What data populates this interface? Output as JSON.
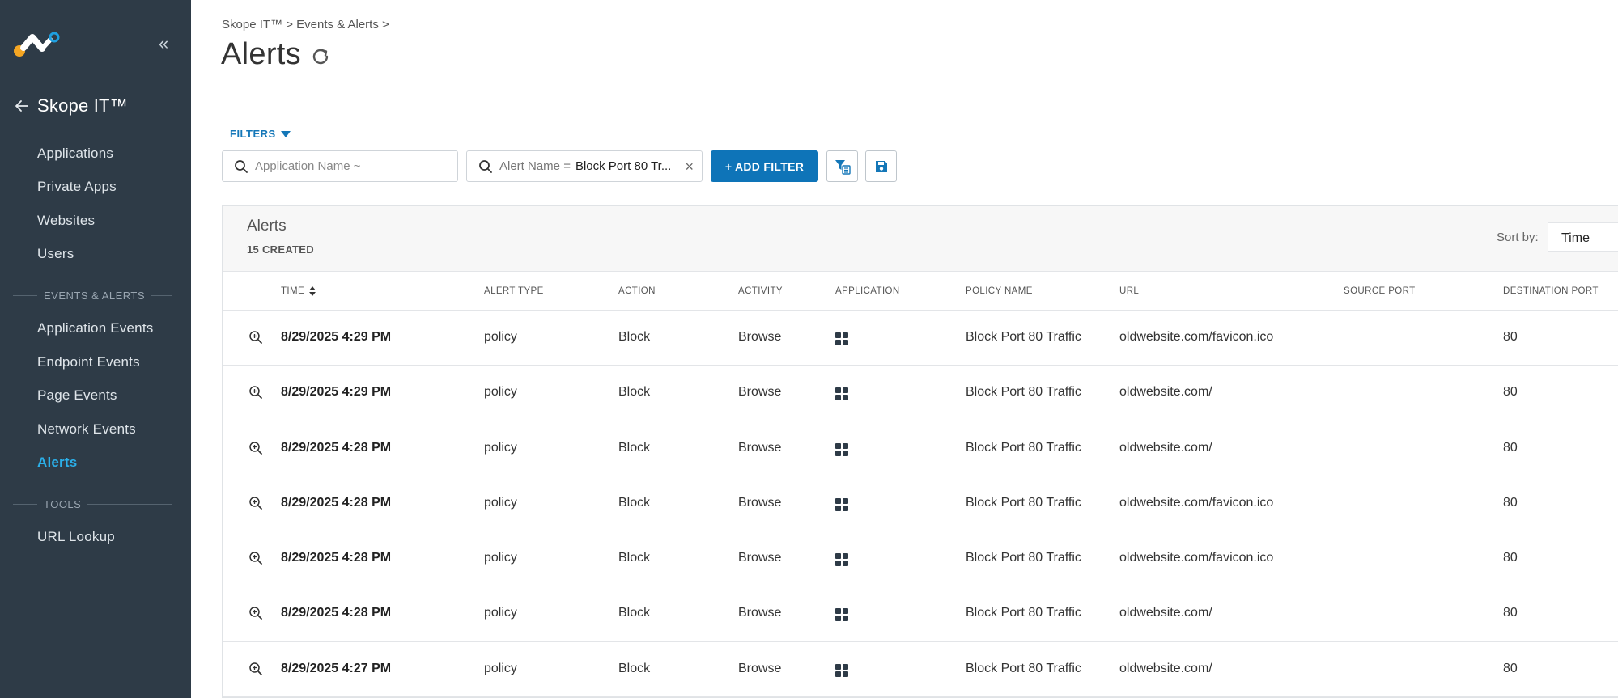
{
  "sidebar": {
    "back_label": "Skope IT™",
    "items": [
      {
        "label": "Applications",
        "active": false
      },
      {
        "label": "Private Apps",
        "active": false
      },
      {
        "label": "Websites",
        "active": false
      },
      {
        "label": "Users",
        "active": false
      }
    ],
    "section_events": "EVENTS & ALERTS",
    "event_items": [
      {
        "label": "Application Events",
        "active": false
      },
      {
        "label": "Endpoint Events",
        "active": false
      },
      {
        "label": "Page Events",
        "active": false
      },
      {
        "label": "Network Events",
        "active": false
      },
      {
        "label": "Alerts",
        "active": true
      }
    ],
    "section_tools": "TOOLS",
    "tool_items": [
      {
        "label": "URL Lookup",
        "active": false
      }
    ],
    "colors": {
      "background": "#2e3b47",
      "active": "#2bb0ea",
      "logo_orange": "#f5a623",
      "logo_blue": "#1e9fe0"
    }
  },
  "header": {
    "breadcrumb": "Skope IT™ > Events & Alerts >",
    "title": "Alerts",
    "refresh_icon": "refresh-icon"
  },
  "filters": {
    "toggle_label": "FILTERS",
    "app_name_placeholder": "Application Name ~",
    "alert_chip_key": "Alert Name =",
    "alert_chip_value": "Block Port 80 Tr...",
    "add_filter_label": "+ ADD FILTER",
    "accent": "#0e74b8"
  },
  "panel": {
    "title": "Alerts",
    "count": "15 CREATED",
    "sort_label": "Sort by:",
    "sort_value": "Time"
  },
  "table": {
    "columns": {
      "time": "TIME",
      "alert_type": "ALERT TYPE",
      "action": "ACTION",
      "activity": "ACTIVITY",
      "application": "APPLICATION",
      "policy_name": "POLICY NAME",
      "url": "URL",
      "source_port": "SOURCE PORT",
      "destination_port": "DESTINATION PORT"
    },
    "rows": [
      {
        "time": "8/29/2025 4:29 PM",
        "alert_type": "policy",
        "action": "Block",
        "activity": "Browse",
        "policy_name": "Block Port 80 Traffic",
        "url": "oldwebsite.com/favicon.ico",
        "source_port": "",
        "destination_port": "80"
      },
      {
        "time": "8/29/2025 4:29 PM",
        "alert_type": "policy",
        "action": "Block",
        "activity": "Browse",
        "policy_name": "Block Port 80 Traffic",
        "url": "oldwebsite.com/",
        "source_port": "",
        "destination_port": "80"
      },
      {
        "time": "8/29/2025 4:28 PM",
        "alert_type": "policy",
        "action": "Block",
        "activity": "Browse",
        "policy_name": "Block Port 80 Traffic",
        "url": "oldwebsite.com/",
        "source_port": "",
        "destination_port": "80"
      },
      {
        "time": "8/29/2025 4:28 PM",
        "alert_type": "policy",
        "action": "Block",
        "activity": "Browse",
        "policy_name": "Block Port 80 Traffic",
        "url": "oldwebsite.com/favicon.ico",
        "source_port": "",
        "destination_port": "80"
      },
      {
        "time": "8/29/2025 4:28 PM",
        "alert_type": "policy",
        "action": "Block",
        "activity": "Browse",
        "policy_name": "Block Port 80 Traffic",
        "url": "oldwebsite.com/favicon.ico",
        "source_port": "",
        "destination_port": "80"
      },
      {
        "time": "8/29/2025 4:28 PM",
        "alert_type": "policy",
        "action": "Block",
        "activity": "Browse",
        "policy_name": "Block Port 80 Traffic",
        "url": "oldwebsite.com/",
        "source_port": "",
        "destination_port": "80"
      },
      {
        "time": "8/29/2025 4:27 PM",
        "alert_type": "policy",
        "action": "Block",
        "activity": "Browse",
        "policy_name": "Block Port 80 Traffic",
        "url": "oldwebsite.com/",
        "source_port": "",
        "destination_port": "80"
      }
    ]
  }
}
